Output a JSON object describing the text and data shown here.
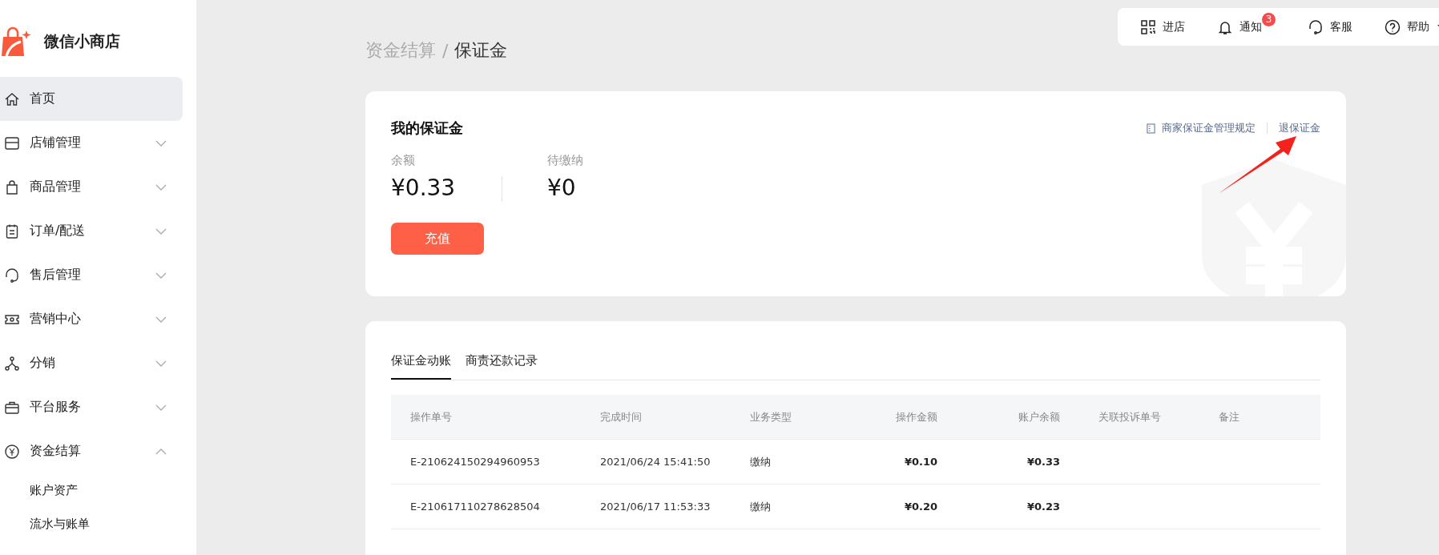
{
  "app": {
    "name": "微信小商店"
  },
  "sidebar": {
    "items": [
      {
        "label": "首页",
        "selected": true
      },
      {
        "label": "店铺管理",
        "selected": false,
        "expanded": false
      },
      {
        "label": "商品管理",
        "selected": false,
        "expanded": false
      },
      {
        "label": "订单/配送",
        "selected": false,
        "expanded": false
      },
      {
        "label": "售后管理",
        "selected": false,
        "expanded": false
      },
      {
        "label": "营销中心",
        "selected": false,
        "expanded": false
      },
      {
        "label": "分销",
        "selected": false,
        "expanded": false
      },
      {
        "label": "平台服务",
        "selected": false,
        "expanded": false
      },
      {
        "label": "资金结算",
        "selected": false,
        "expanded": true,
        "children": [
          {
            "label": "账户资产",
            "selected": false
          },
          {
            "label": "流水与账单",
            "selected": false
          }
        ]
      }
    ]
  },
  "header": {
    "items": [
      {
        "label": "进店"
      },
      {
        "label": "通知",
        "badge": "3"
      },
      {
        "label": "客服"
      },
      {
        "label": "帮助",
        "dropdown": true
      }
    ]
  },
  "breadcrumb": [
    "资金结算",
    "/",
    "保证金"
  ],
  "deposit": {
    "title": "我的保证金",
    "rules_link": "商家保证金管理规定",
    "refund_link": "退保证金",
    "stats": [
      {
        "label": "余额",
        "value": "¥0.33"
      },
      {
        "label": "待缴纳",
        "value": "¥0"
      }
    ],
    "button": "充值"
  },
  "tabs": [
    {
      "label": "保证金动账",
      "selected": true
    },
    {
      "label": "商责还款记录",
      "selected": false
    }
  ],
  "table": {
    "columns": [
      "操作单号",
      "完成时间",
      "业务类型",
      "操作金额",
      "账户余额",
      "关联投诉单号",
      "备注"
    ],
    "rows": [
      [
        "E-210624150294960953",
        "2021/06/24 15:41:50",
        "缴纳",
        "¥0.10",
        "¥0.33",
        "",
        ""
      ],
      [
        "E-210617110278628504",
        "2021/06/17 11:53:33",
        "缴纳",
        "¥0.20",
        "¥0.23",
        "",
        ""
      ]
    ]
  }
}
